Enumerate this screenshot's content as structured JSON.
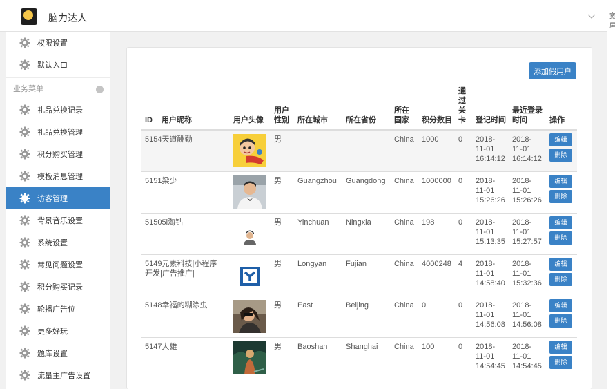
{
  "app": {
    "title": "脑力达人",
    "logo_text": "脑力达人",
    "right_edge_text": [
      "宽",
      "屏"
    ]
  },
  "sidebar": {
    "top_items": [
      {
        "label": "权限设置",
        "icon": "gear-icon"
      },
      {
        "label": "默认入口",
        "icon": "gear-icon"
      }
    ],
    "section_label": "业务菜单",
    "items": [
      {
        "label": "礼品兑换记录",
        "icon": "gear-icon"
      },
      {
        "label": "礼品兑换管理",
        "icon": "gear-icon"
      },
      {
        "label": "积分购买管理",
        "icon": "gear-icon"
      },
      {
        "label": "模板消息管理",
        "icon": "gear-icon"
      },
      {
        "label": "访客管理",
        "icon": "gear-icon",
        "active": true
      },
      {
        "label": "背景音乐设置",
        "icon": "gear-icon"
      },
      {
        "label": "系统设置",
        "icon": "gear-icon"
      },
      {
        "label": "常见问题设置",
        "icon": "gear-icon"
      },
      {
        "label": "积分购买记录",
        "icon": "gear-icon"
      },
      {
        "label": "轮播广告位",
        "icon": "gear-icon"
      },
      {
        "label": "更多好玩",
        "icon": "gear-icon"
      },
      {
        "label": "题库设置",
        "icon": "gear-icon"
      },
      {
        "label": "流量主广告设置",
        "icon": "gear-icon"
      }
    ]
  },
  "main": {
    "add_button": "添加假用户",
    "columns": [
      "ID",
      "用户昵称",
      "用户头像",
      "用户性别",
      "所在城市",
      "所在省份",
      "所在国家",
      "积分数目",
      "通过关卡",
      "登记时间",
      "最近登录时间",
      "操作"
    ],
    "column_display": {
      "gender": [
        "用户",
        "性别"
      ],
      "country": [
        "所在",
        "国家"
      ],
      "level": [
        "通",
        "过",
        "关",
        "卡"
      ],
      "last_login": [
        "最近登录",
        "时间"
      ]
    },
    "edit_label": "编辑",
    "delete_label": "删除",
    "rows": [
      {
        "id": "5154",
        "nickname": "天道酬勤",
        "avatar": "cartoon-avatar",
        "gender": "男",
        "city": "",
        "province": "",
        "country": "China",
        "points": "1000",
        "level": "0",
        "reg_date": [
          "2018-",
          "11-01",
          "16:14:12"
        ],
        "login_date": [
          "2018-",
          "11-01",
          "16:14:12"
        ],
        "highlight": true
      },
      {
        "id": "5151",
        "nickname": "梁少",
        "avatar": "man-avatar",
        "gender": "男",
        "city": "Guangzhou",
        "province": "Guangdong",
        "country": "China",
        "points": "1000000",
        "level": "0",
        "reg_date": [
          "2018-",
          "11-01",
          "15:26:26"
        ],
        "login_date": [
          "2018-",
          "11-01",
          "15:26:26"
        ]
      },
      {
        "id": "5150",
        "nickname": "5i淘钻",
        "avatar": "default-avatar",
        "gender": "男",
        "city": "Yinchuan",
        "province": "Ningxia",
        "country": "China",
        "points": "198",
        "level": "0",
        "reg_date": [
          "2018-",
          "11-01",
          "15:13:35"
        ],
        "login_date": [
          "2018-",
          "11-01",
          "15:27:57"
        ]
      },
      {
        "id": "5149",
        "nickname": "元素科技|小程序开发|广告推广|",
        "avatar": "logo-avatar",
        "gender": "男",
        "city": "Longyan",
        "province": "Fujian",
        "country": "China",
        "points": "4000248",
        "level": "4",
        "reg_date": [
          "2018-",
          "11-01",
          "14:58:40"
        ],
        "login_date": [
          "2018-",
          "11-01",
          "15:32:36"
        ]
      },
      {
        "id": "5148",
        "nickname": "幸福的糊涂虫",
        "avatar": "woman-avatar",
        "gender": "男",
        "city": "East",
        "province": "Beijing",
        "country": "China",
        "points": "0",
        "level": "0",
        "reg_date": [
          "2018-",
          "11-01",
          "14:56:08"
        ],
        "login_date": [
          "2018-",
          "11-01",
          "14:56:08"
        ]
      },
      {
        "id": "5147",
        "nickname": "大雄",
        "avatar": "forest-avatar",
        "gender": "男",
        "city": "Baoshan",
        "province": "Shanghai",
        "country": "China",
        "points": "100",
        "level": "0",
        "reg_date": [
          "2018-",
          "11-01",
          "14:54:45"
        ],
        "login_date": [
          "2018-",
          "11-01",
          "14:54:45"
        ]
      }
    ]
  },
  "colors": {
    "accent": "#3a82c6",
    "sidebar_active_bg": "#3a82c6"
  }
}
